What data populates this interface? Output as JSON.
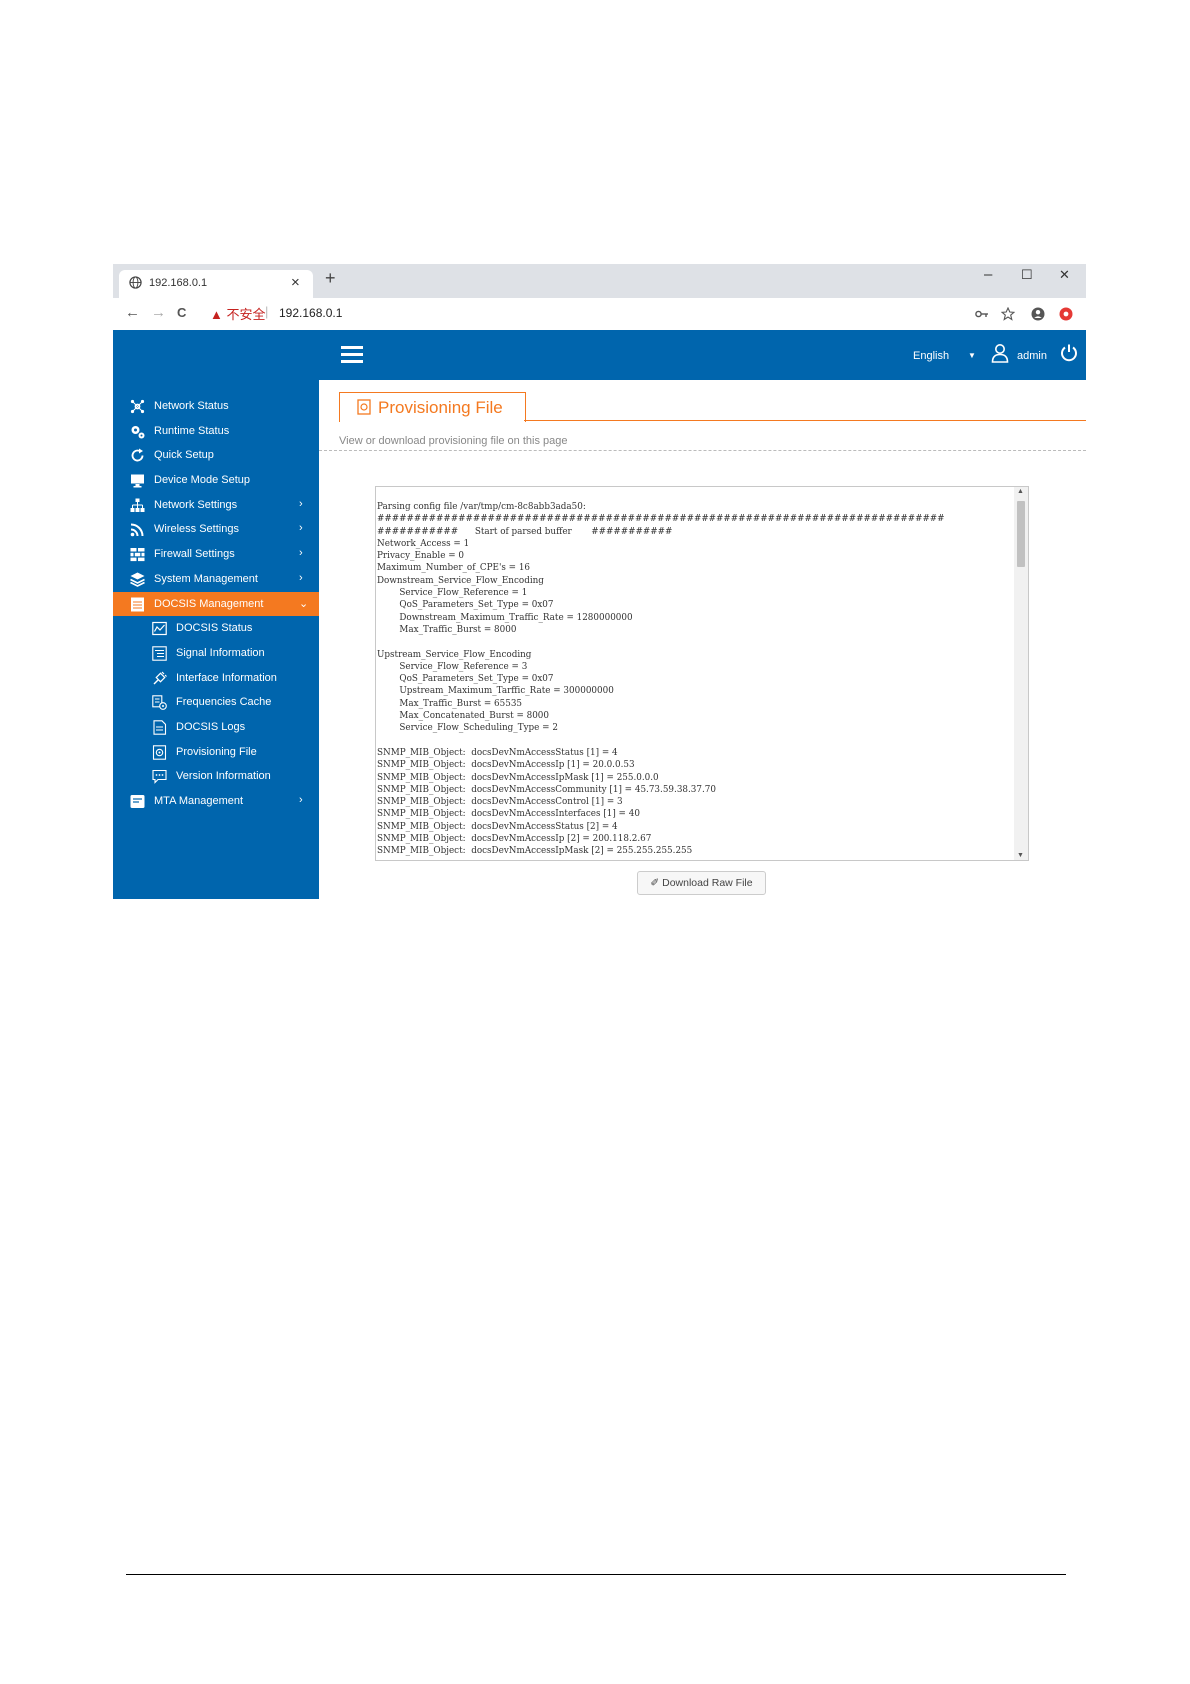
{
  "browser": {
    "tab_title": "192.168.0.1",
    "tab_close": "×",
    "new_tab": "+",
    "win_min": "–",
    "win_max": "☐",
    "win_close": "✕",
    "nav_back": "←",
    "nav_forward": "→",
    "nav_reload": "C",
    "security_warning": "▲ 不安全",
    "address_sep": "|",
    "url": "192.168.0.1"
  },
  "header": {
    "language": "English",
    "user": "admin"
  },
  "sidebar": {
    "items": [
      {
        "label": "Network Status",
        "icon": "network-icon"
      },
      {
        "label": "Runtime Status",
        "icon": "gears-icon"
      },
      {
        "label": "Quick Setup",
        "icon": "refresh-icon"
      },
      {
        "label": "Device Mode Setup",
        "icon": "monitor-icon"
      },
      {
        "label": "Network Settings",
        "icon": "sitemap-icon",
        "chevron": "›"
      },
      {
        "label": "Wireless Settings",
        "icon": "wifi-icon",
        "chevron": "›"
      },
      {
        "label": "Firewall Settings",
        "icon": "firewall-icon",
        "chevron": "›"
      },
      {
        "label": "System Management",
        "icon": "layers-icon",
        "chevron": "›"
      },
      {
        "label": "DOCSIS Management",
        "icon": "docsis-icon",
        "chevron": "⌄",
        "active": true
      },
      {
        "label": "DOCSIS Status",
        "icon": "chart-icon",
        "sub": true
      },
      {
        "label": "Signal Information",
        "icon": "list-icon",
        "sub": true
      },
      {
        "label": "Interface Information",
        "icon": "plug-icon",
        "sub": true
      },
      {
        "label": "Frequencies Cache",
        "icon": "cache-icon",
        "sub": true
      },
      {
        "label": "DOCSIS Logs",
        "icon": "log-icon",
        "sub": true
      },
      {
        "label": "Provisioning File",
        "icon": "file-icon",
        "sub": true
      },
      {
        "label": "Version Information",
        "icon": "chat-icon",
        "sub": true
      },
      {
        "label": "MTA Management",
        "icon": "phone-icon",
        "chevron": "›"
      }
    ]
  },
  "main": {
    "title": "Provisioning File",
    "description": "View or download provisioning file on this page",
    "config_text": "Parsing config file /var/tmp/cm-8c8abb3ada50:\n#############################################################################\n###########      Start of parsed buffer       ###########\nNetwork_Access = 1\nPrivacy_Enable = 0\nMaximum_Number_of_CPE's = 16\nDownstream_Service_Flow_Encoding\n        Service_Flow_Reference = 1\n        QoS_Parameters_Set_Type = 0x07\n        Downstream_Maximum_Traffic_Rate = 1280000000\n        Max_Traffic_Burst = 8000\n\nUpstream_Service_Flow_Encoding\n        Service_Flow_Reference = 3\n        QoS_Parameters_Set_Type = 0x07\n        Upstream_Maximum_Tarffic_Rate = 300000000\n        Max_Traffic_Burst = 65535\n        Max_Concatenated_Burst = 8000\n        Service_Flow_Scheduling_Type = 2\n\nSNMP_MIB_Object:  docsDevNmAccessStatus [1] = 4\nSNMP_MIB_Object:  docsDevNmAccessIp [1] = 20.0.0.53\nSNMP_MIB_Object:  docsDevNmAccessIpMask [1] = 255.0.0.0\nSNMP_MIB_Object:  docsDevNmAccessCommunity [1] = 45.73.59.38.37.70\nSNMP_MIB_Object:  docsDevNmAccessControl [1] = 3\nSNMP_MIB_Object:  docsDevNmAccessInterfaces [1] = 40\nSNMP_MIB_Object:  docsDevNmAccessStatus [2] = 4\nSNMP_MIB_Object:  docsDevNmAccessIp [2] = 200.118.2.67\nSNMP_MIB_Object:  docsDevNmAccessIpMask [2] = 255.255.255.255",
    "download_label": "✐ Download Raw File",
    "scroll_up": "▲",
    "scroll_down": "▼"
  },
  "colors": {
    "primary": "#0065ad",
    "accent": "#f47920"
  }
}
